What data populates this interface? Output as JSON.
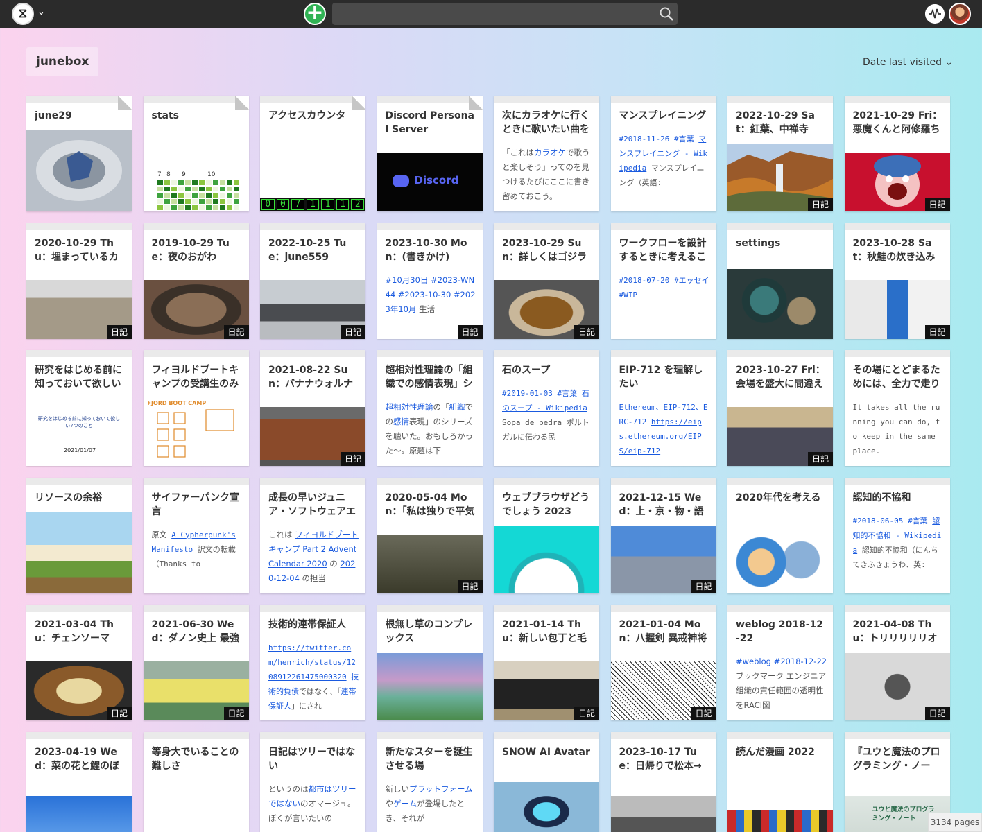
{
  "header": {
    "logo_glyph": "⧖",
    "caret": "⌄",
    "new_glyph": "+",
    "search_placeholder": ""
  },
  "project": {
    "name": "junebox"
  },
  "sort": {
    "label": "Date last visited",
    "caret": "⌄"
  },
  "footer": {
    "page_count": "3134 pages"
  },
  "colors": {
    "topbar": "#2b2b2b",
    "new_button": "#31b355",
    "link": "#1a5adf",
    "badge": "#111111"
  },
  "diary_badge": "日記",
  "cards": [
    {
      "title": "june29",
      "thumb": "ring",
      "pin": true
    },
    {
      "title": "stats",
      "thumb": "stats",
      "pin": true,
      "stats_labels": [
        "7",
        "8",
        "9",
        "10"
      ],
      "stats_legend": "0"
    },
    {
      "title": "アクセスカウンタ",
      "thumb": "counter",
      "pin": true,
      "counter": "0071112"
    },
    {
      "title": "Discord Personal Server",
      "thumb": "discord",
      "pin": true,
      "thumb_text": "Discord"
    },
    {
      "title": "次にカラオケに行くときに歌いたい曲を",
      "desc": [
        {
          "t": "「これは"
        },
        {
          "t": "カラオケ",
          "c": "a"
        },
        {
          "t": "で歌うと楽しそう」ってのを見つけるたびにここに書き留めておこう。"
        }
      ]
    },
    {
      "title": "マンスプレイニング",
      "mono": true,
      "desc": [
        {
          "t": "#2018-11-26",
          "c": "a"
        },
        {
          "t": " "
        },
        {
          "t": "#言葉",
          "c": "a"
        },
        {
          "t": " "
        },
        {
          "t": "マンスプレイニング - Wikipedia",
          "c": "u"
        },
        {
          "t": " マンスプレイニング（英語:"
        }
      ]
    },
    {
      "title": "2022-10-29 Sat：紅葉、中禅寺湖、華",
      "thumb": "waterfall",
      "badge": true
    },
    {
      "title": "2021-10-29 Fri：悪魔くんと阿修羅ち",
      "thumb": "devil",
      "badge": true
    },
    {
      "title": "2020-10-29 Thu：埋まっているカレン",
      "thumb": "man",
      "badge": true
    },
    {
      "title": "2019-10-29 Tue：夜のおがわ",
      "thumb": "fish",
      "badge": true
    },
    {
      "title": "2022-10-25 Tue：june559",
      "thumb": "printer",
      "badge": true
    },
    {
      "title": "2023-10-30 Mon：(書きかけ)",
      "badge": true,
      "desc": [
        {
          "t": "#10月30日",
          "c": "a"
        },
        {
          "t": " "
        },
        {
          "t": "#2023-WN44",
          "c": "a"
        },
        {
          "t": " "
        },
        {
          "t": "#2023-10-30",
          "c": "a"
        },
        {
          "t": " "
        },
        {
          "t": "#2023年10月",
          "c": "a"
        },
        {
          "t": " 生活"
        }
      ]
    },
    {
      "title": "2023-10-29 Sun：詳しくはゴジラ(こ",
      "thumb": "jar",
      "badge": true
    },
    {
      "title": "ワークフローを設計するときに考えるこ",
      "mono": true,
      "desc": [
        {
          "t": "#2018-07-20",
          "c": "a"
        },
        {
          "t": " "
        },
        {
          "t": "#エッセイ",
          "c": "a"
        },
        {
          "t": " "
        },
        {
          "t": "#WIP",
          "c": "a"
        }
      ]
    },
    {
      "title": "settings",
      "thumb": "gears"
    },
    {
      "title": "2023-10-28 Sat：秋鮭の炊き込みご飯",
      "thumb": "bottles",
      "badge": true
    },
    {
      "title": "研究をはじめる前に知っておいて欲しい",
      "thumb": "slide",
      "slide_title": "研究をはじめる前に知っておいて欲しい7つのこと",
      "slide_date": "2021/01/07"
    },
    {
      "title": "フィヨルドブートキャンプの受講生のみ",
      "thumb": "sketch",
      "sketch_label": "FJORD BOOT CAMP"
    },
    {
      "title": "2021-08-22 Sun：バナナウォルナッツ",
      "thumb": "barrel",
      "badge": true
    },
    {
      "title": "超相対性理論の「組織での感情表現」シ",
      "desc": [
        {
          "t": "超相対性理論",
          "c": "a"
        },
        {
          "t": "の「"
        },
        {
          "t": "組織",
          "c": "a"
        },
        {
          "t": "での"
        },
        {
          "t": "感情",
          "c": "a"
        },
        {
          "t": "表現」のシリーズを聴いた。おもしろかった〜。原題は下"
        }
      ]
    },
    {
      "title": "石のスープ",
      "mono": true,
      "desc": [
        {
          "t": "#2019-01-03",
          "c": "a"
        },
        {
          "t": " "
        },
        {
          "t": "#言葉",
          "c": "a"
        },
        {
          "t": " "
        },
        {
          "t": "石のスープ - Wikipedia",
          "c": "u"
        },
        {
          "t": " Sopa de pedra ポルトガルに伝わる民"
        }
      ]
    },
    {
      "title": "EIP-712 を理解したい",
      "mono": true,
      "desc": [
        {
          "t": "Ethereum、EIP-712、ERC-712 ",
          "c": "a"
        },
        {
          "t": "https://eips.ethereum.org/EIPS/eip-712",
          "c": "u"
        }
      ]
    },
    {
      "title": "2023-10-27 Fri：会場を盛大に間違え",
      "thumb": "selfie",
      "badge": true
    },
    {
      "title": "その場にとどまるためには、全力で走り",
      "mono": true,
      "desc": [
        {
          "t": "It takes all the running you can do, to keep in the same place."
        }
      ]
    },
    {
      "title": "リソースの余裕",
      "thumb": "fantasy"
    },
    {
      "title": "サイファーパンク宣言",
      "mono": true,
      "desc": [
        {
          "t": "原文 "
        },
        {
          "t": "A Cypherpunk's Manifesto",
          "c": "u"
        },
        {
          "t": " 訳文の転載（Thanks to"
        }
      ]
    },
    {
      "title": "成長の早いジュニア・ソフトウェアエ",
      "desc": [
        {
          "t": "これは "
        },
        {
          "t": "フィヨルドブートキャンプ Part 2 Advent Calendar 2020",
          "c": "u"
        },
        {
          "t": " の "
        },
        {
          "t": "2020-12-04",
          "c": "u"
        },
        {
          "t": " の担当"
        }
      ]
    },
    {
      "title": "2020-05-04 Mon：「私は独りで平気",
      "thumb": "monkey",
      "badge": true
    },
    {
      "title": "ウェブブラウザどうでしょう 2023",
      "thumb": "shark"
    },
    {
      "title": "2021-12-15 Wed：上・京・物・語",
      "thumb": "city",
      "badge": true
    },
    {
      "title": "2020年代を考える",
      "thumb": "robot"
    },
    {
      "title": "認知的不協和",
      "mono": true,
      "desc": [
        {
          "t": "#2018-06-05",
          "c": "a"
        },
        {
          "t": " "
        },
        {
          "t": "#言葉",
          "c": "a"
        },
        {
          "t": " "
        },
        {
          "t": "認知的不協和 - Wikipedia",
          "c": "u"
        },
        {
          "t": " 認知的不協和（にんちてきふきょうわ、英:"
        }
      ]
    },
    {
      "title": "2021-03-04 Thu：チェンソーマン!! つ",
      "thumb": "food",
      "badge": true
    },
    {
      "title": "2021-06-30 Wed：ダノン史上 最強レ",
      "thumb": "yogurt",
      "badge": true
    },
    {
      "title": "技術的連帯保証人",
      "mono": true,
      "desc": [
        {
          "t": "https://twitter.com/henrich/status/1208912261475000320",
          "c": "u"
        },
        {
          "t": " "
        },
        {
          "t": "技術的負債",
          "c": "a"
        },
        {
          "t": "ではなく、「"
        },
        {
          "t": "連帯保証人",
          "c": "a"
        },
        {
          "t": "」にされ"
        }
      ]
    },
    {
      "title": "根無し草のコンプレックス",
      "thumb": "grass"
    },
    {
      "title": "2021-01-14 Thu：新しい包丁と毛布の",
      "thumb": "boxes",
      "badge": true
    },
    {
      "title": "2021-01-04 Mon：八握剣 異戒神将",
      "thumb": "manga",
      "badge": true
    },
    {
      "title": "weblog 2018-12-22",
      "desc": [
        {
          "t": "#weblog",
          "c": "a"
        },
        {
          "t": " "
        },
        {
          "t": "#2018-12-22",
          "c": "a"
        },
        {
          "t": " ブックマーク エンジニア組織の責任範囲の透明性をRACI図"
        }
      ]
    },
    {
      "title": "2021-04-08 Thu：トリリリリリオンゲ",
      "thumb": "bubble",
      "badge": true
    },
    {
      "title": "2023-04-19 Wed：菜の花と鯉のぼり",
      "thumb": "koi"
    },
    {
      "title": "等身大でいることの難しさ",
      "thumb": "dark"
    },
    {
      "title": "日記はツリーではない",
      "desc": [
        {
          "t": "というのは"
        },
        {
          "t": "都市はツリーではない",
          "c": "a"
        },
        {
          "t": "のオマージュ。ぼくが言いたいの"
        }
      ]
    },
    {
      "title": "新たなスターを誕生させる場",
      "desc": [
        {
          "t": "新しい"
        },
        {
          "t": "プラットフォーム",
          "c": "a"
        },
        {
          "t": "や"
        },
        {
          "t": "ゲーム",
          "c": "a"
        },
        {
          "t": "が登場したとき、それが"
        }
      ]
    },
    {
      "title": "SNOW AI Avatar",
      "thumb": "snow"
    },
    {
      "title": "2023-10-17 Tue：日帰りで松本→東京",
      "thumb": "station"
    },
    {
      "title": "読んだ漫画 2022",
      "thumb": "collage"
    },
    {
      "title": "『ユウと魔法のプログラミング・ノー",
      "thumb": "book",
      "book_text": "ユウと魔法のプログラミング・ノート"
    }
  ]
}
